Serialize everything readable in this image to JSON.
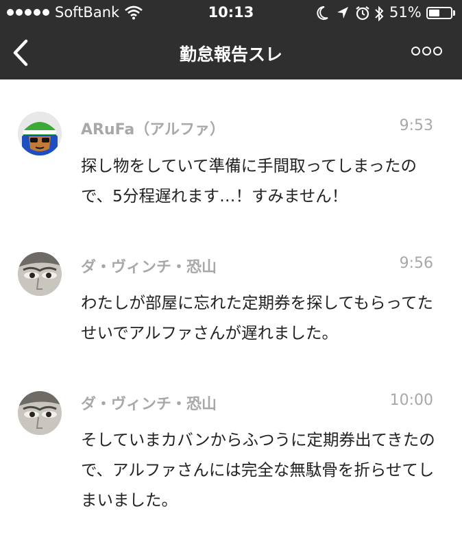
{
  "status_bar": {
    "carrier": "SoftBank",
    "time": "10:13",
    "battery_percent": "51%",
    "battery_level": 0.51,
    "icons": [
      "signal-dots-icon",
      "wifi-icon",
      "moon-icon",
      "location-arrow-icon",
      "alarm-icon",
      "bluetooth-icon",
      "battery-icon"
    ]
  },
  "nav": {
    "back_icon": "chevron-left-icon",
    "title": "勤怠報告スレ",
    "more_icon": "more-options-icon"
  },
  "messages": [
    {
      "author": "ARuFa（アルファ）",
      "time": "9:53",
      "text": "探し物をしていて準備に手間取ってしまったので、5分程遅れます…！すみません！",
      "avatar": "avatar-arufa"
    },
    {
      "author": "ダ・ヴィンチ・恐山",
      "time": "9:56",
      "text": "わたしが部屋に忘れた定期券を探してもらってたせいでアルファさんが遅れました。",
      "avatar": "avatar-davinci"
    },
    {
      "author": "ダ・ヴィンチ・恐山",
      "time": "10:00",
      "text": "そしていまカバンからふつうに定期券出てきたので、アルファさんには完全な無駄骨を折らせてしまいました。",
      "avatar": "avatar-davinci"
    }
  ],
  "colors": {
    "header_background": "#2f2f2f",
    "author_text": "#a8a8a8",
    "message_text": "#222222"
  }
}
